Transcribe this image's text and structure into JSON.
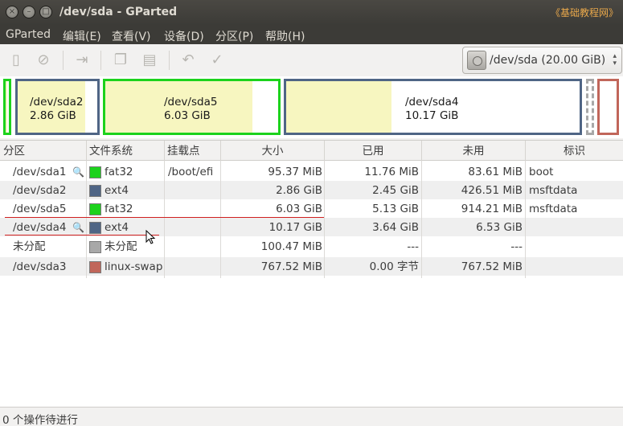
{
  "window": {
    "title": "/dev/sda - GParted",
    "watermark": "《基础教程网》",
    "close_glyph": "×",
    "min_glyph": "–",
    "max_glyph": "□"
  },
  "menu": [
    "GParted",
    "编辑(E)",
    "查看(V)",
    "设备(D)",
    "分区(P)",
    "帮助(H)"
  ],
  "toolbar": {
    "buttons": [
      {
        "name": "new-partition-icon",
        "glyph": "▯"
      },
      {
        "name": "delete-icon",
        "glyph": "⊘"
      },
      {
        "name": "resize-move-icon",
        "glyph": "⇥"
      },
      {
        "name": "copy-icon",
        "glyph": "❐"
      },
      {
        "name": "paste-icon",
        "glyph": "▤"
      },
      {
        "name": "undo-icon",
        "glyph": "↶"
      },
      {
        "name": "apply-icon",
        "glyph": "✓"
      }
    ],
    "device": "/dev/sda   (20.00 GiB)",
    "device_up": "▴",
    "device_down": "▾"
  },
  "map": {
    "sda2": {
      "name": "/dev/sda2",
      "size": "2.86 GiB"
    },
    "sda5": {
      "name": "/dev/sda5",
      "size": "6.03 GiB"
    },
    "sda4": {
      "name": "/dev/sda4",
      "size": "10.17 GiB"
    }
  },
  "columns": [
    "分区",
    "文件系统",
    "挂载点",
    "大小",
    "已用",
    "未用",
    "标识"
  ],
  "rows": [
    {
      "partition": "/dev/sda1",
      "key": true,
      "fs": "fat32",
      "fs_color": "#1cd21c",
      "mount": "/boot/efi",
      "size": "95.37 MiB",
      "used": "11.76 MiB",
      "unused": "83.61 MiB",
      "flags": "boot"
    },
    {
      "partition": "/dev/sda2",
      "key": false,
      "fs": "ext4",
      "fs_color": "#4f6585",
      "mount": "",
      "size": "2.86 GiB",
      "used": "2.45 GiB",
      "unused": "426.51 MiB",
      "flags": "msftdata"
    },
    {
      "partition": "/dev/sda5",
      "key": false,
      "fs": "fat32",
      "fs_color": "#1cd21c",
      "mount": "",
      "size": "6.03 GiB",
      "used": "5.13 GiB",
      "unused": "914.21 MiB",
      "flags": "msftdata"
    },
    {
      "partition": "/dev/sda4",
      "key": true,
      "fs": "ext4",
      "fs_color": "#4f6585",
      "mount": "",
      "size": "10.17 GiB",
      "used": "3.64 GiB",
      "unused": "6.53 GiB",
      "flags": ""
    },
    {
      "partition": "未分配",
      "key": false,
      "fs": "未分配",
      "fs_color": "#a8a8a8",
      "mount": "",
      "size": "100.47 MiB",
      "used": "---",
      "unused": "---",
      "flags": ""
    },
    {
      "partition": "/dev/sda3",
      "key": false,
      "fs": "linux-swap",
      "fs_color": "#c1665a",
      "mount": "",
      "size": "767.52 MiB",
      "used": "0.00 字节",
      "unused": "767.52 MiB",
      "flags": ""
    }
  ],
  "colors": {
    "fat32": "#1cd21c",
    "ext4": "#4f6585",
    "swap": "#c1665a",
    "unallocated": "#a8a8a8",
    "used_fill": "#f7f6c0",
    "annotation_red": "#d02020"
  },
  "status": "0 个操作待进行"
}
